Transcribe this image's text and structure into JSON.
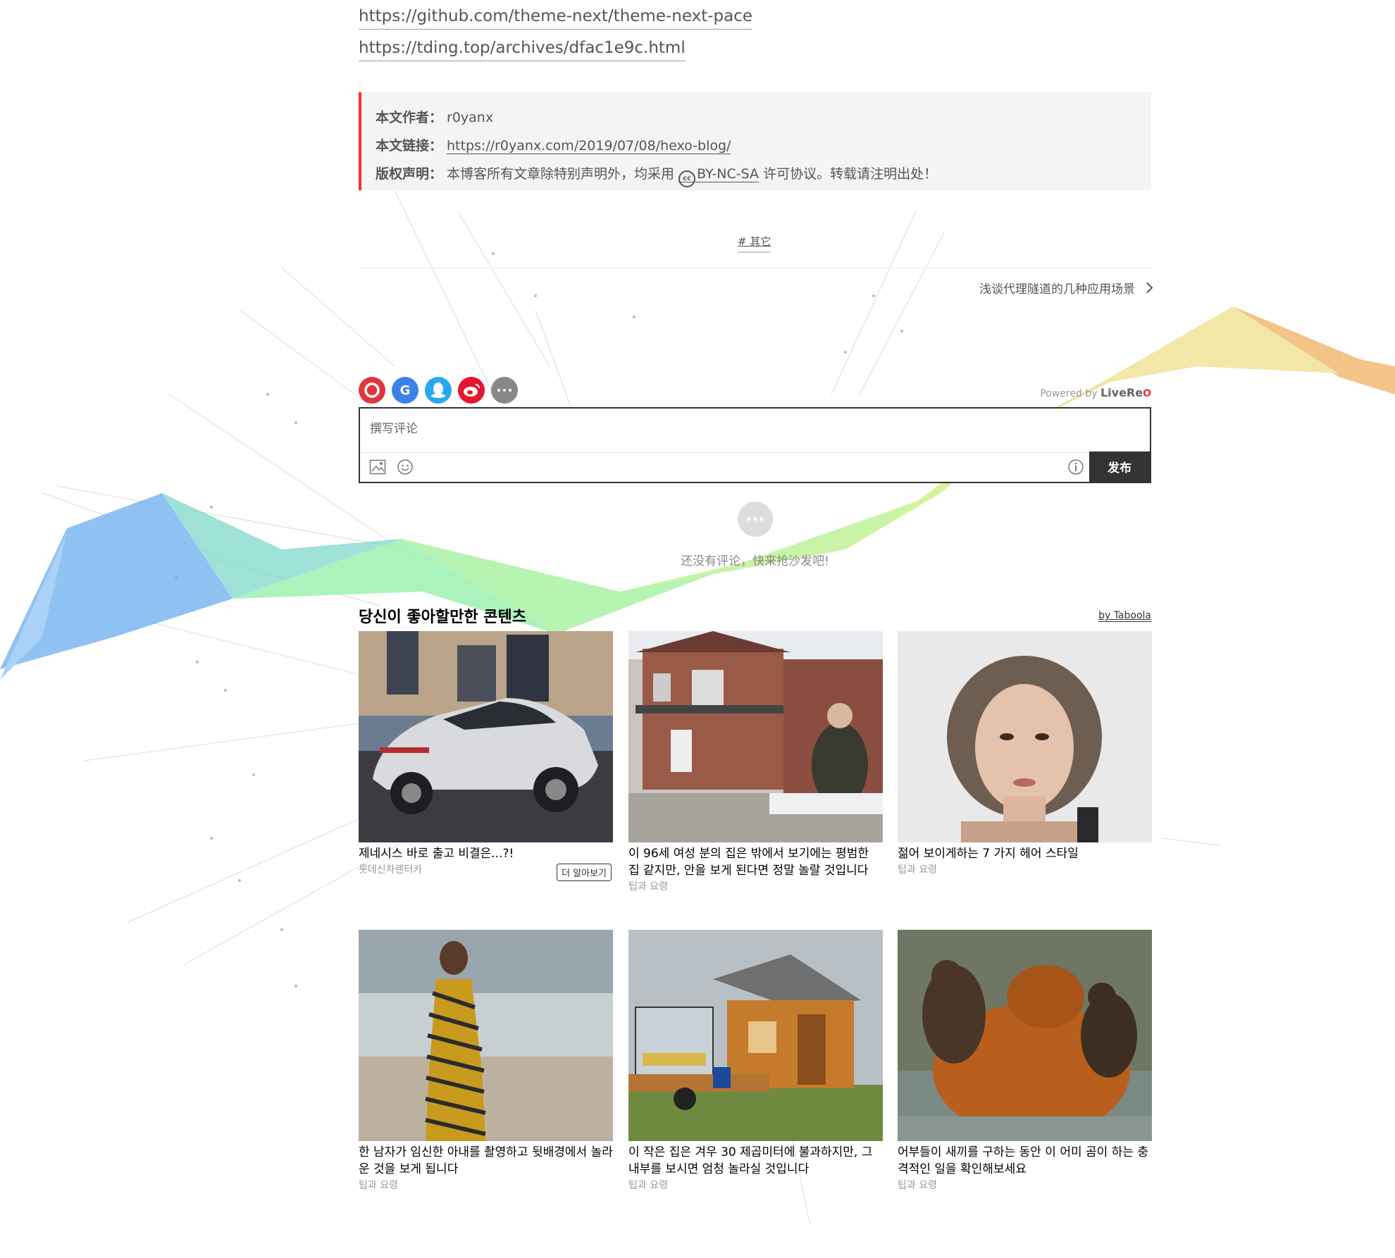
{
  "refs": [
    "https://github.com/theme-next/theme-next-pace",
    "https://tding.top/archives/dfac1e9c.html"
  ],
  "copyright": {
    "author_key": "本文作者：",
    "author": "r0yanx",
    "link_key": "本文链接：",
    "link": "https://r0yanx.com/2019/07/08/hexo-blog/",
    "license_key": "版权声明：",
    "license_pre": "本博客所有文章除特别声明外，均采用",
    "license_name": "BY-NC-SA",
    "license_post": "许可协议。转载请注明出处！"
  },
  "tag": "# 其它",
  "next_post": "浅谈代理隧道的几种应用场景",
  "comments": {
    "powered_by": "Powered by",
    "brand_live": "LiveRe",
    "brand_mark": "O",
    "placeholder": "撰写评论",
    "publish": "发布",
    "empty": "还没有评论，快来抢沙发吧!"
  },
  "taboola": {
    "heading": "당신이 좋아할만한 콘텐츠",
    "brand": "by Taboola",
    "more_button": "더 알아보기",
    "cards": [
      {
        "title": "제네시스 바로 출고 비결은...?!",
        "source": "롯데신차렌터카"
      },
      {
        "title": "이 96세 여성 분의 집은 밖에서 보기에는 평범한 집 같지만, 안을 보게 된다면 정말 놀랄 것입니다",
        "source": "팁과 요령"
      },
      {
        "title": "젊어 보이게하는 7 가지 헤어 스타일",
        "source": "팁과 요령"
      },
      {
        "title": "한 남자가 임신한 아내를 촬영하고 뒷배경에서 놀라운 것을 보게 됩니다",
        "source": "팁과 요령"
      },
      {
        "title": "이 작은 집은 겨우 30 제곱미터에 불과하지만, 그 내부를 보시면 엄청 놀라실 것입니다",
        "source": "팁과 요령"
      },
      {
        "title": "어부들이 새끼를 구하는 동안 이 어미 곰이 하는 충격적인 일을 확인해보세요",
        "source": "팁과 요령"
      }
    ]
  },
  "colors": {
    "accent_border": "#ff2a2a",
    "publish_bg": "#333333",
    "ribbon_blue": "#6aaef0",
    "ribbon_green": "#8ff0a8",
    "ribbon_lime": "#c8f07a",
    "ribbon_yellow": "#e8d878",
    "ribbon_orange": "#f0b060"
  },
  "icons": [
    "livere-login-icon",
    "google-login-icon",
    "qq-login-icon",
    "weibo-login-icon",
    "more-login-icon",
    "image-upload-icon",
    "emoji-icon",
    "info-icon",
    "comment-bubble-icon",
    "cc-license-icon",
    "chevron-right-icon"
  ]
}
